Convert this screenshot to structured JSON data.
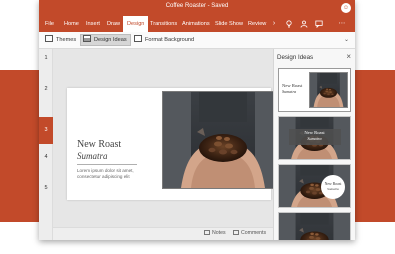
{
  "window": {
    "title": "Coffee Roaster - Saved",
    "avatar": "☺"
  },
  "tabs": {
    "file": "File",
    "home": "Home",
    "insert": "Insert",
    "draw": "Draw",
    "design": "Design",
    "transitions": "Transitions",
    "animations": "Animations",
    "slide_show": "Slide Show",
    "review": "Review"
  },
  "tab_icons": {
    "tell_me": "lightbulb-icon",
    "share": "share-icon",
    "comments": "comment-icon",
    "more": "more-icon"
  },
  "ribbon": {
    "themes": "Themes",
    "design_ideas": "Design Ideas",
    "format_background": "Format Background"
  },
  "slide_numbers": [
    "1",
    "2",
    "3",
    "4",
    "5"
  ],
  "slide": {
    "title": "New Roast",
    "subtitle": "Sumatra",
    "body": "Lorem ipsum dolor sit amet, consectetur adipiscing elit"
  },
  "status": {
    "notes": "Notes",
    "comments": "Comments"
  },
  "design_panel": {
    "title": "Design Ideas",
    "ideas": [
      {
        "title": "New Roast",
        "subtitle": "Sumatra"
      },
      {
        "title": "New Roast",
        "subtitle": "Sumatra"
      },
      {
        "title": "New Roast",
        "subtitle": "Sumatra"
      },
      {
        "title": "",
        "subtitle": ""
      }
    ]
  },
  "colors": {
    "accent": "#c24a2a",
    "ribbon_bg": "#fafafa",
    "canvas_bg": "#e6e6e6"
  }
}
